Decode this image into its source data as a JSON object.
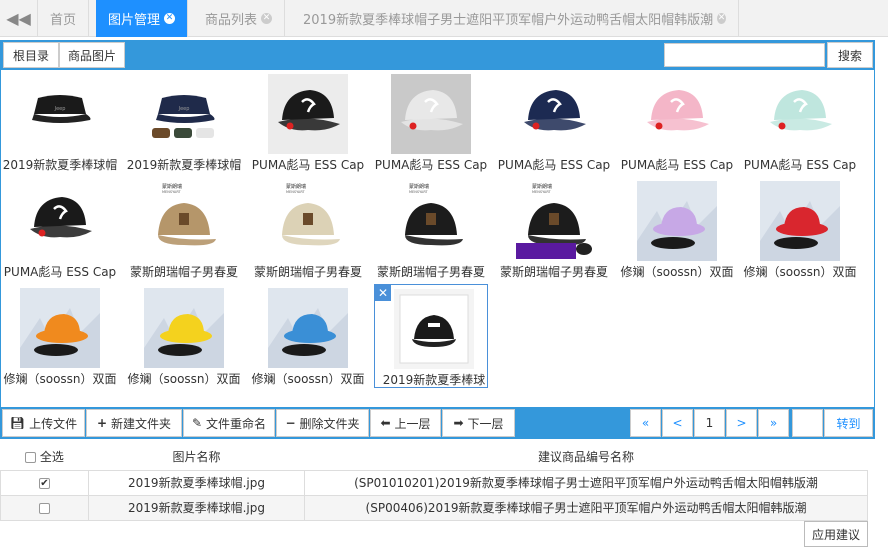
{
  "tabs": {
    "home": "首页",
    "image_manage": "图片管理",
    "product_list": "商品列表",
    "product_detail": "2019新款夏季棒球帽子男士遮阳平顶军帽户外运动鸭舌帽太阳帽韩版潮"
  },
  "toolbar": {
    "root_dir": "根目录",
    "product_images": "商品图片",
    "search_placeholder": "",
    "search_label": "搜索"
  },
  "images": [
    {
      "caption": "2019新款夏季棒球帽",
      "kind": "flatcap-black"
    },
    {
      "caption": "2019新款夏季棒球帽",
      "kind": "flatcap-multi"
    },
    {
      "caption": "PUMA彪马 ESS Cap",
      "kind": "puma-black"
    },
    {
      "caption": "PUMA彪马 ESS Cap",
      "kind": "puma-grey"
    },
    {
      "caption": "PUMA彪马 ESS Cap",
      "kind": "puma-navy"
    },
    {
      "caption": "PUMA彪马 ESS Cap",
      "kind": "puma-pink"
    },
    {
      "caption": "PUMA彪马 ESS Cap",
      "kind": "puma-mint"
    },
    {
      "caption": "PUMA彪马 ESS Cap",
      "kind": "puma-black2"
    },
    {
      "caption": "蒙斯朗瑞帽子男春夏",
      "kind": "brand-khaki"
    },
    {
      "caption": "蒙斯朗瑞帽子男春夏",
      "kind": "brand-beige"
    },
    {
      "caption": "蒙斯朗瑞帽子男春夏",
      "kind": "brand-black"
    },
    {
      "caption": "蒙斯朗瑞帽子男春夏",
      "kind": "brand-black-promo"
    },
    {
      "caption": "修斓（soossn）双面",
      "kind": "bucket-purple"
    },
    {
      "caption": "修斓（soossn）双面",
      "kind": "bucket-red"
    },
    {
      "caption": "修斓（soossn）双面",
      "kind": "bucket-orange"
    },
    {
      "caption": "修斓（soossn）双面",
      "kind": "bucket-yellow"
    },
    {
      "caption": "修斓（soossn）双面",
      "kind": "bucket-blue"
    },
    {
      "caption": "2019新款夏季棒球",
      "kind": "photo-cap",
      "selected": true
    }
  ],
  "brand_mark": "蒙斯朗瑞\nMENSYART",
  "actions": {
    "upload": "上传文件",
    "new_folder": "新建文件夹",
    "rename_folder": "文件重命名",
    "delete_folder": "删除文件夹",
    "up_level": "上一层",
    "down_level": "下一层"
  },
  "pagination": {
    "first": "«",
    "prev": "<",
    "current": "1",
    "next": ">",
    "last": "»",
    "goto_value": "",
    "goto_label": "转到"
  },
  "table": {
    "select_all": "全选",
    "col_name": "图片名称",
    "col_suggest": "建议商品编号名称",
    "rows": [
      {
        "checked": true,
        "name": "2019新款夏季棒球帽.jpg",
        "suggest": "(SP01010201)2019新款夏季棒球帽子男士遮阳平顶军帽户外运动鸭舌帽太阳帽韩版潮"
      },
      {
        "checked": false,
        "name": "2019新款夏季棒球帽.jpg",
        "suggest": "(SP00406)2019新款夏季棒球帽子男士遮阳平顶军帽户外运动鸭舌帽太阳帽韩版潮"
      }
    ]
  },
  "apply_label": "应用建议",
  "colors": {
    "accent": "#1e90ff",
    "toolbar_blue": "#3498db",
    "selection_border": "#4a90d9"
  }
}
